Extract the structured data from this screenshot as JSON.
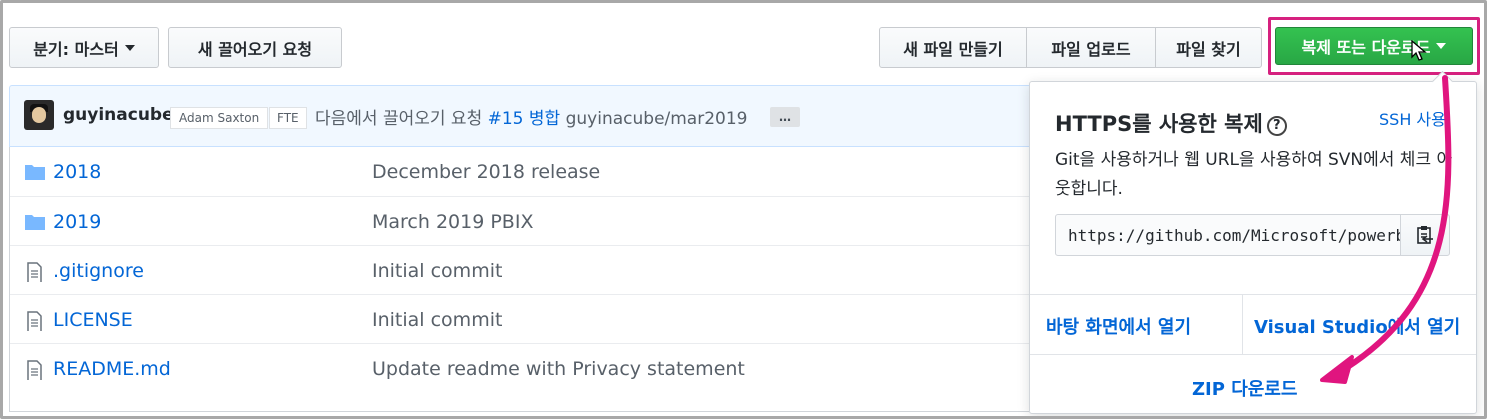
{
  "toolbar": {
    "branch_label": "분기: 마스터",
    "new_pr_label": "새 끌어오기 요청",
    "create_file_label": "새 파일 만들기",
    "upload_files_label": "파일 업로드",
    "find_file_label": "파일 찾기",
    "clone_label": "복제 또는 다운로드"
  },
  "commit": {
    "author": "guyinacube",
    "coauthor_1": "Adam Saxton",
    "coauthor_2": "FTE",
    "message_prefix": "다음에서 끌어오기 요청",
    "pr_link": "#15",
    "merge_word": "병합",
    "branch": "guyinacube/mar2019",
    "expand_label": "…"
  },
  "files": [
    {
      "name": "2018",
      "type": "folder",
      "message": "December 2018 release"
    },
    {
      "name": "2019",
      "type": "folder",
      "message": "March 2019 PBIX"
    },
    {
      "name": ".gitignore",
      "type": "file",
      "message": "Initial commit"
    },
    {
      "name": "LICENSE",
      "type": "file",
      "message": "Initial commit"
    },
    {
      "name": "README.md",
      "type": "file",
      "message": "Update readme with Privacy statement"
    }
  ],
  "clone_dropdown": {
    "title": "HTTPS를 사용한 복제",
    "help_icon": "?",
    "ssh_link": "SSH 사용",
    "description": "Git을 사용하거나 웹 URL을 사용하여 SVN에서 체크 아웃합니다.",
    "url_value": "https://github.com/Microsoft/powerbi-desktop-samples.git",
    "open_desktop_label": "바탕 화면에서 열기",
    "open_vs_label": "Visual Studio에서 열기",
    "download_zip_label": "ZIP 다운로드"
  },
  "colors": {
    "accent_green": "#2ea44f",
    "link_blue": "#0366d6",
    "annotation_magenta": "#e0157f"
  }
}
